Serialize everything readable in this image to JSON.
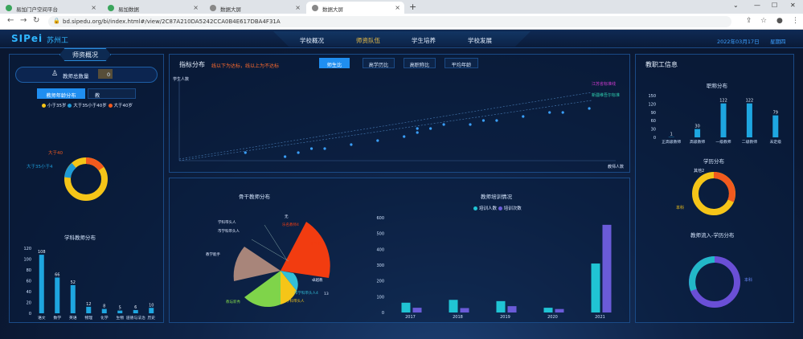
{
  "browser": {
    "tabs": [
      {
        "title": "易加门户空间平台",
        "icon": "#3aa55c"
      },
      {
        "title": "易加数据",
        "icon": "#3aa55c"
      },
      {
        "title": "数据大屏",
        "icon": "#888"
      },
      {
        "title": "数据大屏",
        "icon": "#888"
      }
    ],
    "new_tab": "+",
    "url": "bd.sipedu.org/bi/index.html#/view/2C87A210DA5242CCA0B4E617DBA4F31A"
  },
  "header": {
    "logo": "SIPei",
    "city": "苏州工",
    "nav": [
      "学校概况",
      "师资队伍",
      "学生培养",
      "学校发展"
    ],
    "date": "2022年03月17日",
    "weekday": "星期四"
  },
  "left": {
    "title": "师资概况",
    "total_label": "教师总数量",
    "total_value": "0",
    "tab_active": "教师年龄分布",
    "tab_other": "教",
    "age_legend": [
      "小于35岁",
      "大于35小于40岁",
      "大于40岁"
    ],
    "age_colors": [
      "#f5c518",
      "#1e9ad6",
      "#f25a1e"
    ],
    "age_labels": [
      "大于40",
      "大于35小于4"
    ],
    "subject_title": "学科教师分布",
    "subject_chart": {
      "type": "bar",
      "categories": [
        "语文",
        "数学",
        "英语",
        "物理",
        "化学",
        "生物",
        "道德与法治",
        "历史"
      ],
      "values": [
        108,
        66,
        52,
        12,
        8,
        5,
        6,
        10
      ],
      "ylim": [
        0,
        120
      ]
    }
  },
  "middle": {
    "title": "指标分布",
    "hint": "线以下为达标，线以上为不达标",
    "tabs": [
      "师生比",
      "高学历比",
      "高职称比",
      "平均年龄"
    ],
    "ylabel": "学生人数",
    "xlabel": "教师人数",
    "legend": [
      "江苏省标准线",
      "新疆维吾尔标准"
    ],
    "scatter": {
      "type": "scatter",
      "x": [
        5,
        8,
        9,
        10,
        11,
        13,
        15,
        17,
        18,
        18,
        19,
        20,
        22,
        23,
        24,
        26,
        28,
        29,
        31
      ],
      "y": [
        2,
        1,
        2,
        3,
        3,
        4,
        5,
        6,
        8,
        7,
        8,
        9,
        9,
        10,
        10,
        11,
        12,
        12,
        13
      ],
      "xlim": [
        0,
        33
      ],
      "ylim": [
        0,
        20
      ]
    },
    "backbone_title": "骨干教师分布",
    "backbone_labels": [
      "无",
      "乐名教师4",
      "学科带头人",
      "市学科带头人",
      "教学能手",
      "数学能手",
      "教坛新秀",
      "市学科带头人4",
      "学科带头人",
      "卓越教",
      "13"
    ],
    "training_title": "教师培训情况",
    "training_legend": [
      "培训人数",
      "培训次数"
    ],
    "training_chart": {
      "type": "bar",
      "categories": [
        "2017",
        "2018",
        "2019",
        "2020",
        "2021"
      ],
      "series": [
        {
          "name": "培训人数",
          "values": [
            62,
            80,
            72,
            30,
            310
          ]
        },
        {
          "name": "培训次数",
          "values": [
            30,
            28,
            40,
            22,
            555
          ]
        }
      ],
      "ylim": [
        0,
        600
      ]
    }
  },
  "right": {
    "title": "教职工信息",
    "rank_title": "职称分布",
    "rank_chart": {
      "type": "bar",
      "categories": [
        "正高级教师",
        "高级教师",
        "一级教师",
        "二级教师",
        "未定级"
      ],
      "values": [
        1,
        30,
        122,
        122,
        79
      ],
      "ylim": [
        0,
        150
      ]
    },
    "edu_title": "学历分布",
    "edu_labels": [
      "其他2",
      "本科"
    ],
    "flow_title": "教师流入-学历分布",
    "flow_label": "本科"
  }
}
